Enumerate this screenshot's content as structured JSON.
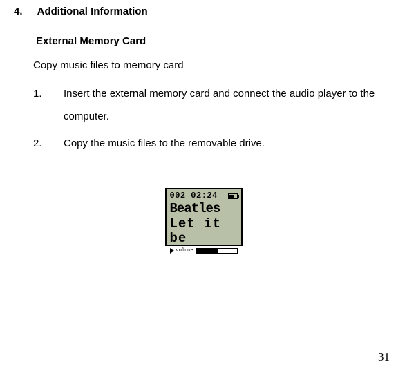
{
  "section": {
    "number": "4.",
    "title": "Additional Information"
  },
  "subheading": "External Memory Card",
  "intro": "Copy music files to memory card",
  "steps": [
    {
      "number": "1.",
      "text": "Insert the external memory card and connect the audio player to the computer."
    },
    {
      "number": "2.",
      "text": "Copy the music files to the removable drive."
    }
  ],
  "player_display": {
    "track_info": "002 02:24",
    "line1": "Beatles",
    "line2": "Let it be",
    "volume_label": "volume"
  },
  "page_number": "31"
}
